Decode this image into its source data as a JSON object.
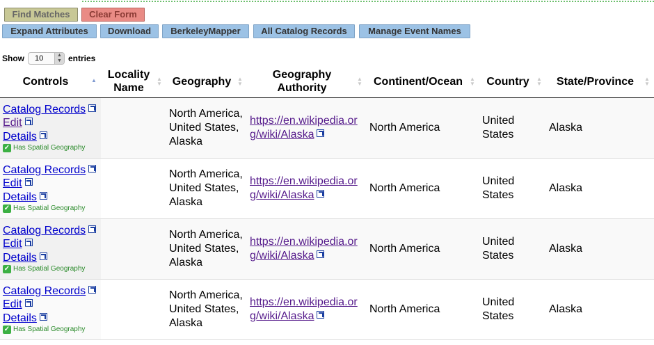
{
  "toolbar": {
    "find_matches": "Find Matches",
    "clear_form": "Clear Form",
    "expand_attributes": "Expand Attributes",
    "download": "Download",
    "berkeleymapper": "BerkeleyMapper",
    "all_catalog_records": "All Catalog Records",
    "manage_event_names": "Manage Event Names"
  },
  "length": {
    "show": "Show",
    "value": "10",
    "entries": "entries"
  },
  "columns": {
    "controls": "Controls",
    "locality_name": "Locality Name",
    "geography": "Geography",
    "geography_authority": "Geography Authority",
    "continent_ocean": "Continent/Ocean",
    "country": "Country",
    "state_province": "State/Province"
  },
  "rows": [
    {
      "catalog_records": "Catalog Records",
      "edit": "Edit",
      "details": "Details",
      "spatial": "Has Spatial Geography",
      "locality_name": "",
      "geography": "North America, United States, Alaska",
      "authority": "https://en.wikipedia.org/wiki/Alaska",
      "continent": "North America",
      "country": "United States",
      "state": "Alaska"
    },
    {
      "catalog_records": "Catalog Records",
      "edit": "Edit",
      "details": "Details",
      "spatial": "Has Spatial Geography",
      "locality_name": "",
      "geography": "North America, United States, Alaska",
      "authority": "https://en.wikipedia.org/wiki/Alaska",
      "continent": "North America",
      "country": "United States",
      "state": "Alaska"
    },
    {
      "catalog_records": "Catalog Records",
      "edit": "Edit",
      "details": "Details",
      "spatial": "Has Spatial Geography",
      "locality_name": "",
      "geography": "North America, United States, Alaska",
      "authority": "https://en.wikipedia.org/wiki/Alaska",
      "continent": "North America",
      "country": "United States",
      "state": "Alaska"
    },
    {
      "catalog_records": "Catalog Records",
      "edit": "Edit",
      "details": "Details",
      "spatial": "Has Spatial Geography",
      "locality_name": "",
      "geography": "North America, United States, Alaska",
      "authority": "https://en.wikipedia.org/wiki/Alaska",
      "continent": "North America",
      "country": "United States",
      "state": "Alaska"
    }
  ]
}
